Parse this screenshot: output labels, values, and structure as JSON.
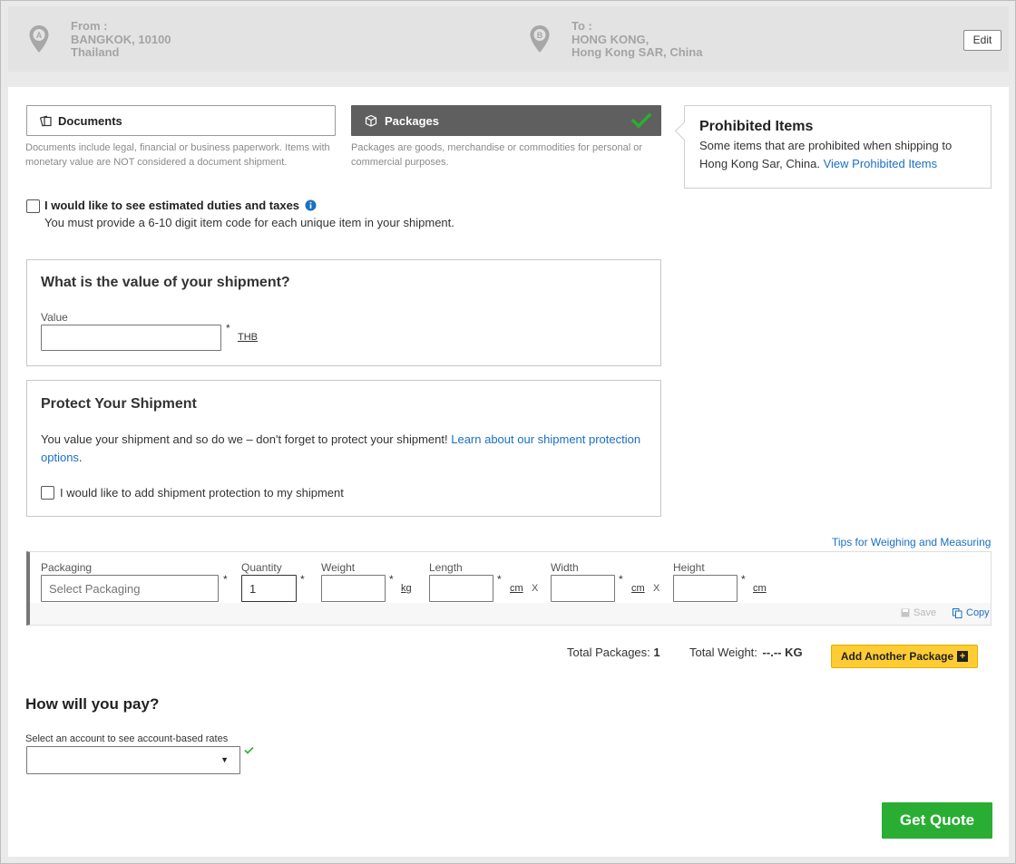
{
  "route": {
    "from_label": "From :",
    "from_line1": "BANGKOK, 10100",
    "from_line2": "Thailand",
    "from_pin_letter": "A",
    "to_label": "To :",
    "to_line1": "HONG KONG,",
    "to_line2": "Hong Kong SAR, China",
    "to_pin_letter": "B",
    "edit_label": "Edit"
  },
  "shipment_type": {
    "documents_label": "Documents",
    "documents_desc": "Documents include legal, financial or business paperwork. Items with monetary value are NOT considered a document shipment.",
    "packages_label": "Packages",
    "packages_desc": "Packages are goods, merchandise or commodities for personal or commercial purposes.",
    "selected": "Packages"
  },
  "prohibited": {
    "title": "Prohibited Items",
    "text": "Some items that are prohibited when shipping to Hong Kong Sar, China.",
    "link": "View Prohibited Items"
  },
  "duties": {
    "label": "I would like to see estimated duties and taxes",
    "note": "You must provide a 6-10 digit item code for each unique item in your shipment.",
    "checked": false
  },
  "value_panel": {
    "title": "What is the value of your shipment?",
    "field_label": "Value",
    "value": "",
    "currency": "THB",
    "required_mark": "*"
  },
  "protect_panel": {
    "title": "Protect Your Shipment",
    "text": "You value your shipment and so do we – don't forget to protect your shipment!",
    "link": "Learn about our shipment protection options",
    "link_end": ".",
    "checkbox_label": "I would like to add shipment protection to my shipment",
    "checked": false
  },
  "package": {
    "tips_link": "Tips for Weighing and Measuring",
    "packaging_label": "Packaging",
    "packaging_placeholder": "Select Packaging",
    "quantity_label": "Quantity",
    "quantity_value": "1",
    "weight_label": "Weight",
    "weight_unit": "kg",
    "length_label": "Length",
    "width_label": "Width",
    "height_label": "Height",
    "dim_unit": "cm",
    "times": "X",
    "required_mark": "*",
    "save_label": "Save",
    "copy_label": "Copy"
  },
  "totals": {
    "packages_label": "Total Packages:",
    "packages_value": "1",
    "weight_label": "Total Weight:",
    "weight_value": "--.-- KG",
    "add_label": "Add Another Package",
    "add_icon": "+"
  },
  "payment": {
    "title": "How will you pay?",
    "select_label": "Select an account to see account-based rates",
    "selected_value": "",
    "caret": "▼"
  },
  "get_quote_label": "Get Quote",
  "colors": {
    "accent_green": "#2aad33",
    "link_blue": "#1a6fc4",
    "yellow": "#ffcc33",
    "selected_dark": "#5f5f5f"
  }
}
